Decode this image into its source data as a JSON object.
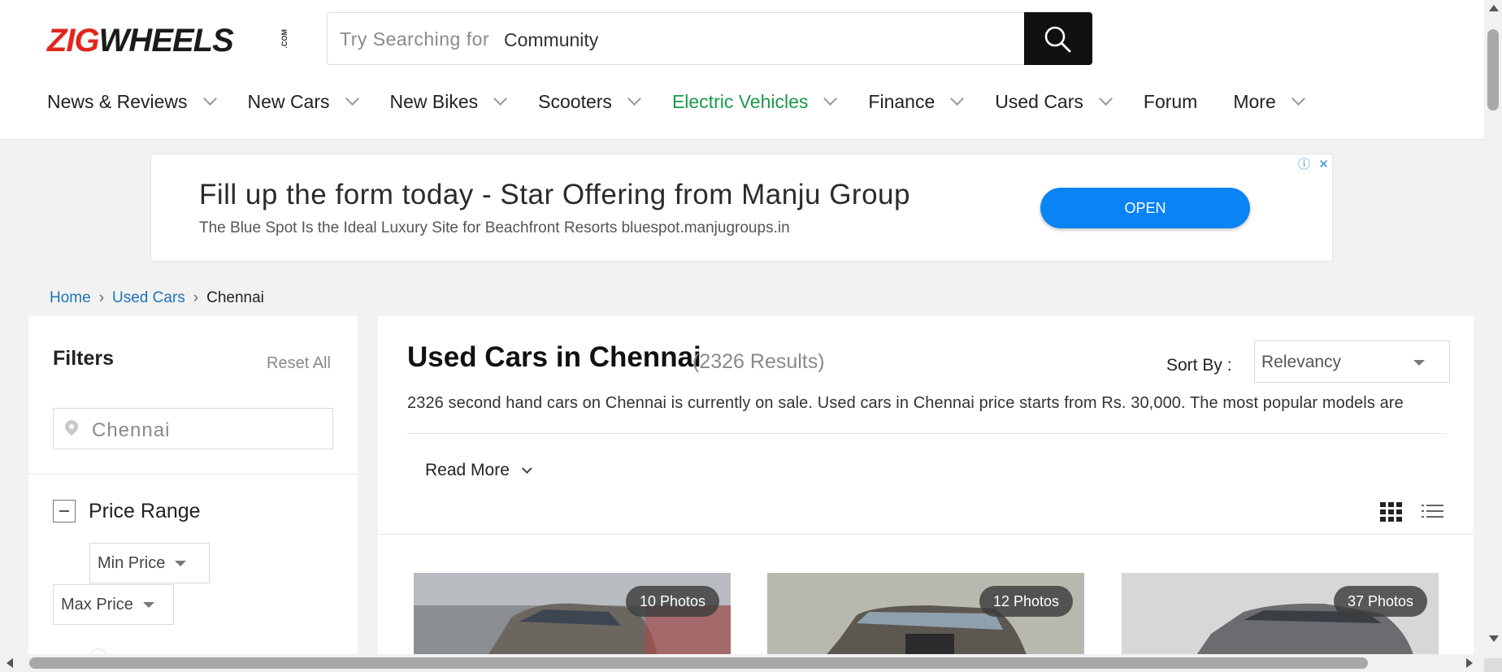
{
  "logo": {
    "part1": "ZIG",
    "part2": "WHEELS",
    "suffix": ".COM"
  },
  "search": {
    "prefix": "Try Searching for",
    "value": "Community",
    "icon": "search-icon"
  },
  "nav": [
    {
      "label": "News & Reviews",
      "has_dropdown": true
    },
    {
      "label": "New Cars",
      "has_dropdown": true
    },
    {
      "label": "New Bikes",
      "has_dropdown": true
    },
    {
      "label": "Scooters",
      "has_dropdown": true
    },
    {
      "label": "Electric Vehicles",
      "has_dropdown": true,
      "color": "#1a9a48"
    },
    {
      "label": "Finance",
      "has_dropdown": true
    },
    {
      "label": "Used Cars",
      "has_dropdown": true
    },
    {
      "label": "Forum",
      "has_dropdown": false
    },
    {
      "label": "More",
      "has_dropdown": true
    }
  ],
  "ad": {
    "title": "Fill up the form today - Star Offering from Manju Group",
    "subtitle": "The Blue Spot Is the Ideal Luxury Site for Beachfront Resorts bluespot.manjugroups.in",
    "button": "OPEN",
    "info_icon": "ⓘ",
    "close_icon": "✕"
  },
  "breadcrumb": {
    "home": "Home",
    "used_cars": "Used Cars",
    "current": "Chennai",
    "separator": "›"
  },
  "filters": {
    "title": "Filters",
    "reset": "Reset All",
    "city": "Chennai",
    "price_range": "Price Range",
    "min_price": "Min Price",
    "max_price": "Max Price"
  },
  "main": {
    "title": "Used Cars in Chennai",
    "count": "(2326 Results)",
    "sort_label": "Sort By :",
    "sort_value": "Relevancy",
    "description": "2326 second hand cars on Chennai is currently on sale. Used cars in Chennai price starts from Rs. 30,000. The most popular models are",
    "read_more": "Read More"
  },
  "cards": [
    {
      "photos": "10 Photos"
    },
    {
      "photos": "12 Photos"
    },
    {
      "photos": "37 Photos"
    }
  ],
  "colors": {
    "brand_red": "#e1261c",
    "link_blue": "#1f74b5",
    "ev_green": "#1a9a48",
    "ad_button": "#0a83f5"
  }
}
